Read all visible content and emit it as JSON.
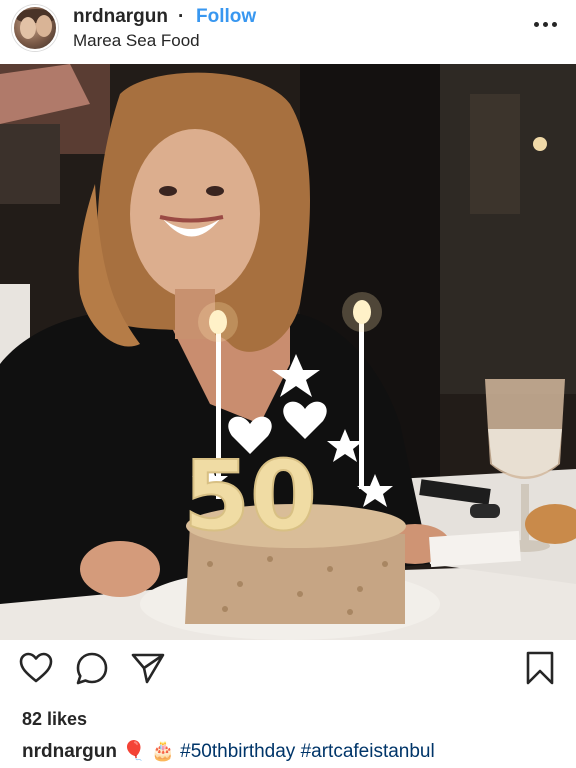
{
  "header": {
    "username": "nrdnargun",
    "separator": "·",
    "follow_label": "Follow",
    "location": "Marea Sea Food",
    "more_icon": "more-options-icon"
  },
  "photo": {
    "description_icon": "post-photo",
    "cake_number": "50"
  },
  "actions": {
    "like_icon": "heart-icon",
    "comment_icon": "comment-icon",
    "share_icon": "paper-plane-icon",
    "save_icon": "bookmark-icon"
  },
  "likes": "82 likes",
  "caption": {
    "username": "nrdnargun",
    "emojis": "🎈 🎂",
    "hashtags": "#50thbirthday #artcafeistanbul"
  }
}
